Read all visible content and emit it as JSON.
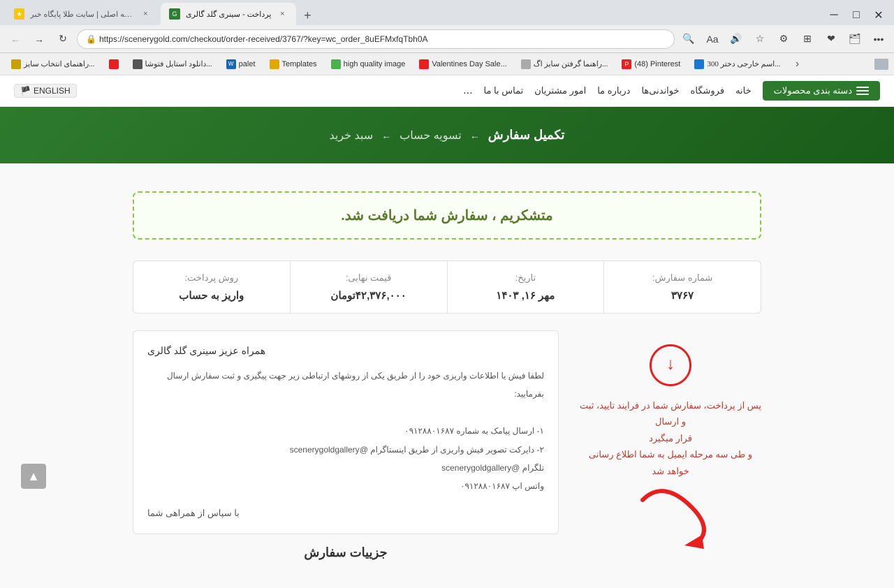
{
  "browser": {
    "tabs": [
      {
        "id": "tab1",
        "favicon_color": "#f5c518",
        "label": "صفحه اصلی | سایت طلا پایگاه خبر",
        "active": false,
        "close_label": "×"
      },
      {
        "id": "tab2",
        "favicon_color": "#2e7d32",
        "label": "پرداخت - سینری گلد گالری",
        "active": true,
        "close_label": "×"
      }
    ],
    "add_tab_label": "+",
    "url": "https://scenerygold.com/checkout/order-received/3767/?key=wc_order_8uEFMxfqTbh0A",
    "nav": {
      "back_label": "←",
      "forward_label": "→",
      "refresh_label": "↻",
      "home_label": "⌂"
    },
    "toolbar_icons": [
      "🔍",
      "👤",
      "🔖",
      "⊞",
      "❤",
      "🗂",
      "…"
    ]
  },
  "bookmarks": [
    {
      "label": "راهنمای انتخاب سایز...",
      "favicon_color": "#e0e0e0"
    },
    {
      "label": "",
      "favicon_color": "#e91e1e",
      "is_img": true
    },
    {
      "label": "دانلود استایل فتوشا...",
      "favicon_color": "#e0e0e0"
    },
    {
      "label": "palet",
      "favicon_color": "#1565c0"
    },
    {
      "label": "Templates",
      "favicon_color": "#e0a800"
    },
    {
      "label": "high quality image",
      "favicon_color": "#e0e0e0"
    },
    {
      "label": "Valentines Day Sale...",
      "favicon_color": "#e91e1e"
    },
    {
      "label": "راهنما گرفتن سایز اگ...",
      "favicon_color": "#e0e0e0"
    },
    {
      "label": "(48) Pinterest",
      "favicon_color": "#e91e1e"
    },
    {
      "label": "300 اسم خارجی دختر...",
      "favicon_color": "#e0e0e0"
    },
    {
      "more": true
    }
  ],
  "site": {
    "nav_items": [
      {
        "label": "خانه"
      },
      {
        "label": "فروشگاه"
      },
      {
        "label": "خواندنی‌ها"
      },
      {
        "label": "درباره ما"
      },
      {
        "label": "امور مشتریان"
      },
      {
        "label": "تماس با ما"
      }
    ],
    "menu_btn_label": "دسته بندی محصولات",
    "more_btn_label": "...",
    "lang_label": "ENGLISH"
  },
  "breadcrumb": {
    "items": [
      {
        "label": "سبد خرید",
        "active": false
      },
      {
        "label": "تسویه حساب",
        "active": false
      },
      {
        "label": "تکمیل سفارش",
        "active": true
      }
    ],
    "arrow": "←"
  },
  "order": {
    "thankyou_text": "متشکریم ، سفارش شما دریافت شد.",
    "fields": [
      {
        "label": "شماره سفارش:",
        "value": "۳۷۶۷"
      },
      {
        "label": "تاریخ:",
        "value": "مهر ۱۶, ۱۴۰۳"
      },
      {
        "label": "قیمت نهایی:",
        "value": "۴۲,۳۷۶,۰۰۰تومان"
      },
      {
        "label": "روش پرداخت:",
        "value": "واریز به حساب"
      }
    ],
    "contact_greeting": "همراه عزیز سینری گلد گالری",
    "contact_intro": "لطفا فیش یا اطلاعات واریزی خود را از طریق یکی از روشهای ارتباطی زیر جهت پیگیری و ثبت سفارش ارسال بفرمایید:",
    "contact_items": [
      "۱- ارسال پیامک به شماره ۰۹۱۲۸۸۰۱۶۸۷",
      "۲- دایرکت تصویر فیش واریزی از طریق اینستاگرام @scenerygoldgallery",
      "تلگرام @scenerygoldgallery",
      "واتس اپ ۰۹۱۲۸۸۰۱۶۸۷"
    ],
    "thanks_label": "با سپاس از همراهی شما",
    "details_title": "جزییات سفارش",
    "steps_lines": [
      "پس از پرداخت، سفارش شما در فرایند تایید، ثبت و ارسال",
      "قرار میگیرد",
      "و طی سه مرحله ایمیل به شما اطلاع رسانی خواهد شد"
    ]
  },
  "scroll_top_label": "▲"
}
